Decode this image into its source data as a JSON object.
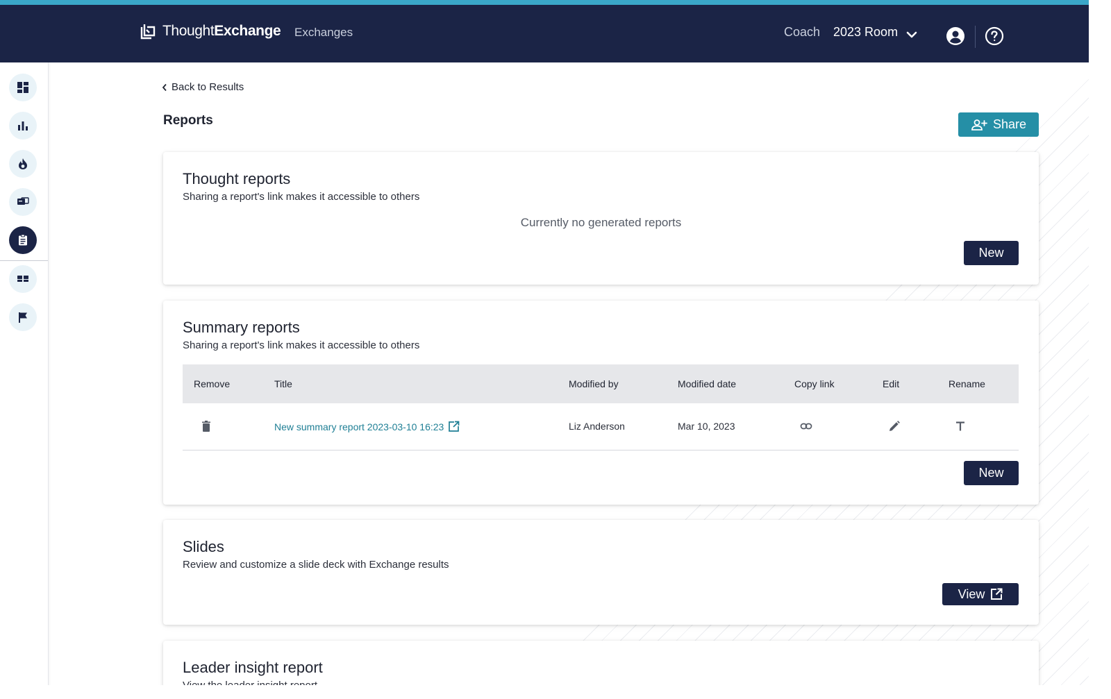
{
  "header": {
    "brand_light": "Thought",
    "brand_bold": "Exchange",
    "nav_exchanges": "Exchanges",
    "coach": "Coach",
    "room": "2023 Room"
  },
  "sidebar": {
    "items": [
      {
        "name": "dashboard"
      },
      {
        "name": "analytics"
      },
      {
        "name": "hot-topics"
      },
      {
        "name": "messages"
      },
      {
        "name": "reports",
        "active": true
      },
      {
        "name": "quotes"
      },
      {
        "name": "flag"
      }
    ]
  },
  "main": {
    "back_label": "Back to Results",
    "page_title": "Reports",
    "share_label": "Share"
  },
  "thought_reports": {
    "title": "Thought reports",
    "subtitle": "Sharing a report's link makes it accessible to others",
    "empty": "Currently no generated reports",
    "new_label": "New"
  },
  "summary_reports": {
    "title": "Summary reports",
    "subtitle": "Sharing a report's link makes it accessible to others",
    "columns": {
      "remove": "Remove",
      "title": "Title",
      "modified_by": "Modified by",
      "modified_date": "Modified date",
      "copy_link": "Copy link",
      "edit": "Edit",
      "rename": "Rename"
    },
    "rows": [
      {
        "title": "New summary report 2023-03-10 16:23",
        "modified_by": "Liz Anderson",
        "modified_date": "Mar 10, 2023"
      }
    ],
    "new_label": "New"
  },
  "slides": {
    "title": "Slides",
    "subtitle": "Review and customize a slide deck with Exchange results",
    "view_label": "View"
  },
  "leader_insight": {
    "title": "Leader insight report",
    "subtitle": "View the leader insight report"
  },
  "colors": {
    "navy": "#1b2446",
    "accent_top": "#3aa7c9",
    "share_teal": "#258fa6",
    "link_teal": "#1f7f95"
  }
}
